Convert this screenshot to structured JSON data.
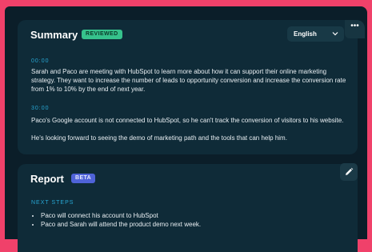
{
  "colors": {
    "frame": "#f0416a",
    "panel_bg": "#0b1e29",
    "card_bg": "#0f2b38",
    "accent_blue": "#27a7d4",
    "reviewed_badge": "#36c28c",
    "beta_badge": "#4f63d8"
  },
  "summary": {
    "title": "Summary",
    "badge": "REVIEWED",
    "language": "English",
    "more_icon": "more-dots-icon",
    "entries": [
      {
        "time": "00:00",
        "text": "Sarah and Paco are meeting with HubSpot to learn more about how it can support their online marketing strategy. They want to increase the number of leads to opportunity conversion and increase the conversion rate from 1% to 10% by the end of next year."
      },
      {
        "time": "30:00",
        "text": "Paco's Google account is not connected to HubSpot, so he can't track the conversion of visitors to his website.",
        "text2": "He's looking forward to seeing the demo of marketing path and the tools that can help him."
      }
    ]
  },
  "report": {
    "title": "Report",
    "badge": "BETA",
    "edit_icon": "pencil-icon",
    "section_label": "NEXT STEPS",
    "steps": [
      "Paco will connect his account to HubSpot",
      "Paco and Sarah will attend the product demo next week."
    ]
  }
}
